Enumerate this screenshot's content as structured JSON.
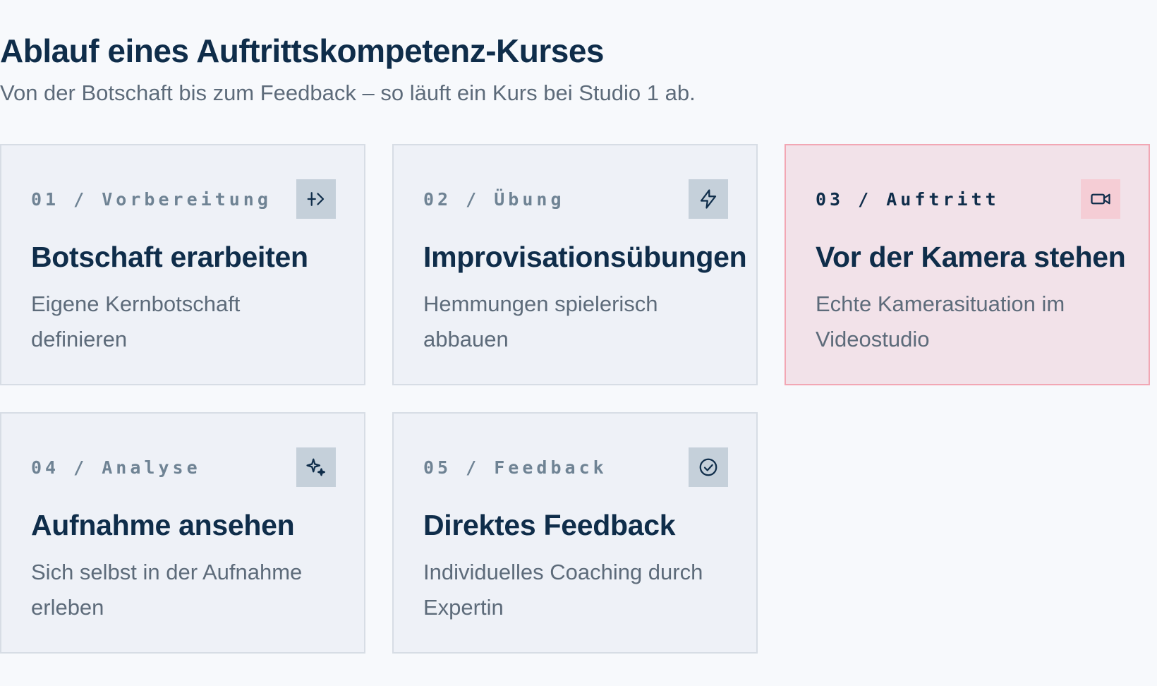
{
  "header": {
    "title": "Ablauf eines Auftrittskompetenz-Kurses",
    "subtitle": "Von der Botschaft bis zum Feedback – so läuft ein Kurs bei Studio 1 ab."
  },
  "steps": [
    {
      "label": "01 / Vorbereitung",
      "title": "Botschaft erarbeiten",
      "description": "Eigene Kernbotschaft definieren",
      "icon": "arrow-into-bracket-icon",
      "highlighted": false
    },
    {
      "label": "02 / Übung",
      "title": "Improvisationsübungen",
      "description": "Hemmungen spielerisch abbauen",
      "icon": "lightning-icon",
      "highlighted": false
    },
    {
      "label": "03 / Auftritt",
      "title": "Vor der Kamera stehen",
      "description": "Echte Kamerasituation im Videostudio",
      "icon": "video-camera-icon",
      "highlighted": true
    },
    {
      "label": "04 / Analyse",
      "title": "Aufnahme ansehen",
      "description": "Sich selbst in der Aufnahme erleben",
      "icon": "sparkles-icon",
      "highlighted": false
    },
    {
      "label": "05 / Feedback",
      "title": "Direktes Feedback",
      "description": "Individuelles Coaching durch Expertin",
      "icon": "check-circle-icon",
      "highlighted": false
    }
  ],
  "colors": {
    "background": "#f7f9fc",
    "card_background": "#eef1f7",
    "card_border": "#d7dde5",
    "highlight_background": "#f2e2e9",
    "highlight_border": "#f2a7b4",
    "heading_text": "#0f2d4a",
    "muted_text": "#5d6b7a",
    "step_label": "#6f8394",
    "icon_box": "#c5d0da",
    "highlight_icon_box": "#f5cdd5"
  }
}
